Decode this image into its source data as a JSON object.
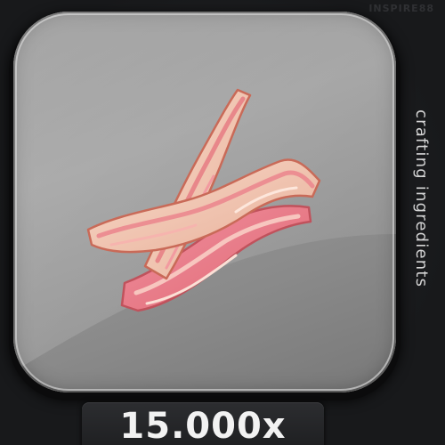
{
  "watermark": "INSPIRE88",
  "item": {
    "icon": "bacon-strips-icon",
    "category_label": "crafting ingredients",
    "quantity": "15.000x"
  },
  "colors": {
    "tile": "#8c8c8c",
    "background": "#18191b",
    "meat_fat": "#f2c3ae",
    "meat_lean": "#e87a82"
  }
}
